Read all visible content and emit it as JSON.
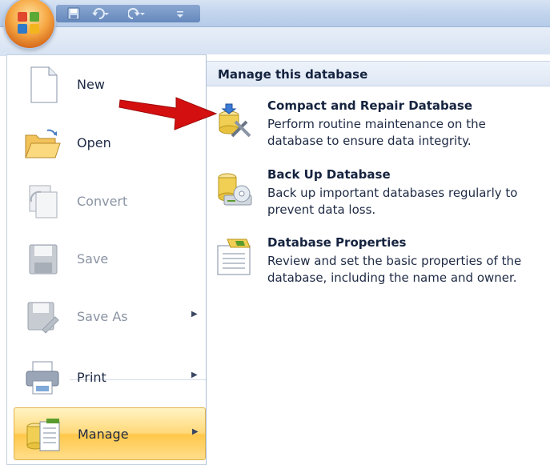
{
  "menu": {
    "items": [
      {
        "label": "New",
        "state": "enabled",
        "has_submenu": false
      },
      {
        "label": "Open",
        "state": "enabled",
        "has_submenu": false
      },
      {
        "label": "Convert",
        "state": "disabled",
        "has_submenu": false
      },
      {
        "label": "Save",
        "state": "disabled",
        "has_submenu": false
      },
      {
        "label": "Save As",
        "state": "disabled",
        "has_submenu": true
      },
      {
        "label": "Print",
        "state": "enabled",
        "has_submenu": true
      },
      {
        "label": "Manage",
        "state": "selected",
        "has_submenu": true
      }
    ]
  },
  "submenu": {
    "heading": "Manage this database",
    "items": [
      {
        "title": "Compact and Repair Database",
        "desc_line1": "Perform routine maintenance on the",
        "desc_line2": "database to ensure data integrity."
      },
      {
        "title": "Back Up Database",
        "desc_line1": "Back up important databases regularly to",
        "desc_line2": "prevent data loss."
      },
      {
        "title": "Database Properties",
        "desc_line1": "Review and set the basic properties of the",
        "desc_line2": "database, including the name and owner."
      }
    ]
  },
  "icons": {
    "office_button": "office-logo-icon",
    "qat": [
      "save-icon",
      "undo-icon",
      "redo-icon",
      "customize-qat-icon"
    ],
    "menu": [
      "new-document-icon",
      "open-folder-icon",
      "convert-icon",
      "save-icon",
      "save-as-icon",
      "print-icon",
      "manage-icon"
    ],
    "submenu": [
      "compact-repair-icon",
      "backup-database-icon",
      "database-properties-icon"
    ]
  },
  "colors": {
    "selected_item": "#ffd97a",
    "annotation_arrow": "#d40f0f",
    "disabled_text": "#8a93a3"
  }
}
